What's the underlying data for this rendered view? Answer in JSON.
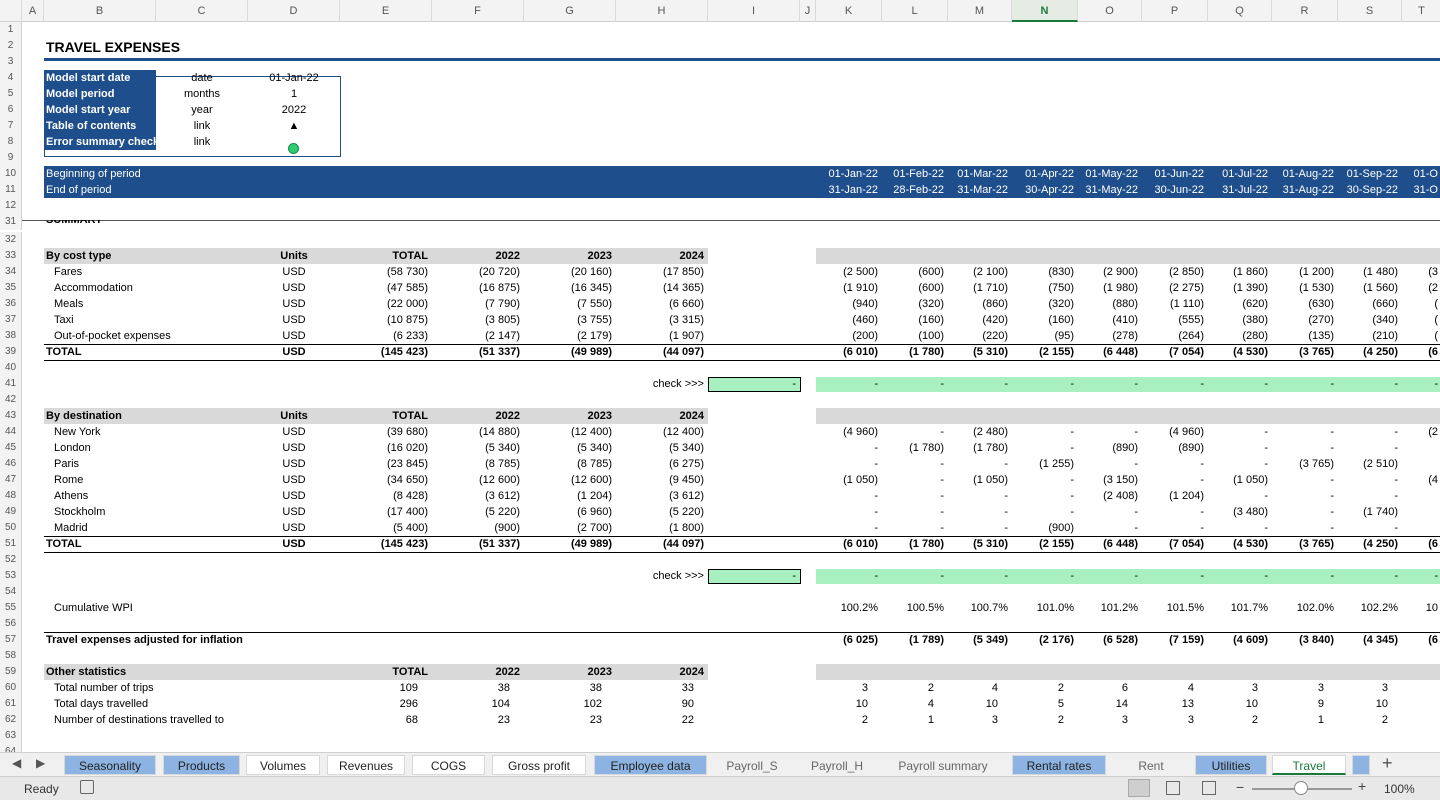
{
  "columns": [
    "A",
    "B",
    "C",
    "D",
    "E",
    "F",
    "G",
    "H",
    "I",
    "J",
    "K",
    "L",
    "M",
    "N",
    "O",
    "P",
    "Q",
    "R",
    "S",
    "T"
  ],
  "rows": [
    "1",
    "2",
    "3",
    "4",
    "5",
    "6",
    "7",
    "8",
    "9",
    "10",
    "11",
    "12",
    "31",
    "32",
    "33",
    "34",
    "35",
    "36",
    "37",
    "38",
    "39",
    "40",
    "41",
    "42",
    "43",
    "44",
    "45",
    "46",
    "47",
    "48",
    "49",
    "50",
    "51",
    "52",
    "53",
    "54",
    "55",
    "56",
    "57",
    "58",
    "59",
    "60",
    "61",
    "62",
    "63",
    "64"
  ],
  "title": "TRAVEL EXPENSES",
  "params": [
    {
      "label": "Model start date",
      "unit": "date",
      "value": "01-Jan-22"
    },
    {
      "label": "Model period",
      "unit": "months",
      "value": "1"
    },
    {
      "label": "Model start year",
      "unit": "year",
      "value": "2022"
    },
    {
      "label": "Table of contents",
      "unit": "link",
      "value": "▲"
    },
    {
      "label": "Error summary check",
      "unit": "link",
      "value": ""
    }
  ],
  "period": {
    "begin_label": "Beginning of period",
    "end_label": "End of period",
    "begin": [
      "01-Jan-22",
      "01-Feb-22",
      "01-Mar-22",
      "01-Apr-22",
      "01-May-22",
      "01-Jun-22",
      "01-Jul-22",
      "01-Aug-22",
      "01-Sep-22",
      "01-O"
    ],
    "end": [
      "31-Jan-22",
      "28-Feb-22",
      "31-Mar-22",
      "30-Apr-22",
      "31-May-22",
      "30-Jun-22",
      "31-Jul-22",
      "31-Aug-22",
      "30-Sep-22",
      "31-O"
    ]
  },
  "summary_label": "SUMMARY",
  "header_cols": [
    "Units",
    "TOTAL",
    "2022",
    "2023",
    "2024"
  ],
  "by_cost": {
    "title": "By cost type",
    "rows": [
      {
        "name": "Fares",
        "unit": "USD",
        "vals": [
          "(58 730)",
          "(20 720)",
          "(20 160)",
          "(17 850)"
        ],
        "m": [
          "(2 500)",
          "(600)",
          "(2 100)",
          "(830)",
          "(2 900)",
          "(2 850)",
          "(1 860)",
          "(1 200)",
          "(1 480)",
          "(3"
        ]
      },
      {
        "name": "Accommodation",
        "unit": "USD",
        "vals": [
          "(47 585)",
          "(16 875)",
          "(16 345)",
          "(14 365)"
        ],
        "m": [
          "(1 910)",
          "(600)",
          "(1 710)",
          "(750)",
          "(1 980)",
          "(2 275)",
          "(1 390)",
          "(1 530)",
          "(1 560)",
          "(2"
        ]
      },
      {
        "name": "Meals",
        "unit": "USD",
        "vals": [
          "(22 000)",
          "(7 790)",
          "(7 550)",
          "(6 660)"
        ],
        "m": [
          "(940)",
          "(320)",
          "(860)",
          "(320)",
          "(880)",
          "(1 110)",
          "(620)",
          "(630)",
          "(660)",
          "("
        ]
      },
      {
        "name": "Taxi",
        "unit": "USD",
        "vals": [
          "(10 875)",
          "(3 805)",
          "(3 755)",
          "(3 315)"
        ],
        "m": [
          "(460)",
          "(160)",
          "(420)",
          "(160)",
          "(410)",
          "(555)",
          "(380)",
          "(270)",
          "(340)",
          "("
        ]
      },
      {
        "name": "Out-of-pocket expenses",
        "unit": "USD",
        "vals": [
          "(6 233)",
          "(2 147)",
          "(2 179)",
          "(1 907)"
        ],
        "m": [
          "(200)",
          "(100)",
          "(220)",
          "(95)",
          "(278)",
          "(264)",
          "(280)",
          "(135)",
          "(210)",
          "("
        ]
      }
    ],
    "total": {
      "name": "TOTAL",
      "unit": "USD",
      "vals": [
        "(145 423)",
        "(51 337)",
        "(49 989)",
        "(44 097)"
      ],
      "m": [
        "(6 010)",
        "(1 780)",
        "(5 310)",
        "(2 155)",
        "(6 448)",
        "(7 054)",
        "(4 530)",
        "(3 765)",
        "(4 250)",
        "(6"
      ]
    }
  },
  "check_label": "check >>>",
  "check_value": "-",
  "by_dest": {
    "title": "By destination",
    "rows": [
      {
        "name": "New York",
        "unit": "USD",
        "vals": [
          "(39 680)",
          "(14 880)",
          "(12 400)",
          "(12 400)"
        ],
        "m": [
          "(4 960)",
          "-",
          "(2 480)",
          "-",
          "-",
          "(4 960)",
          "-",
          "-",
          "-",
          "(2"
        ]
      },
      {
        "name": "London",
        "unit": "USD",
        "vals": [
          "(16 020)",
          "(5 340)",
          "(5 340)",
          "(5 340)"
        ],
        "m": [
          "-",
          "(1 780)",
          "(1 780)",
          "-",
          "(890)",
          "(890)",
          "-",
          "-",
          "-",
          ""
        ]
      },
      {
        "name": "Paris",
        "unit": "USD",
        "vals": [
          "(23 845)",
          "(8 785)",
          "(8 785)",
          "(6 275)"
        ],
        "m": [
          "-",
          "-",
          "-",
          "(1 255)",
          "-",
          "-",
          "-",
          "(3 765)",
          "(2 510)",
          ""
        ]
      },
      {
        "name": "Rome",
        "unit": "USD",
        "vals": [
          "(34 650)",
          "(12 600)",
          "(12 600)",
          "(9 450)"
        ],
        "m": [
          "(1 050)",
          "-",
          "(1 050)",
          "-",
          "(3 150)",
          "-",
          "(1 050)",
          "-",
          "-",
          "(4"
        ]
      },
      {
        "name": "Athens",
        "unit": "USD",
        "vals": [
          "(8 428)",
          "(3 612)",
          "(1 204)",
          "(3 612)"
        ],
        "m": [
          "-",
          "-",
          "-",
          "-",
          "(2 408)",
          "(1 204)",
          "-",
          "-",
          "-",
          ""
        ]
      },
      {
        "name": "Stockholm",
        "unit": "USD",
        "vals": [
          "(17 400)",
          "(5 220)",
          "(6 960)",
          "(5 220)"
        ],
        "m": [
          "-",
          "-",
          "-",
          "-",
          "-",
          "-",
          "(3 480)",
          "-",
          "(1 740)",
          ""
        ]
      },
      {
        "name": "Madrid",
        "unit": "USD",
        "vals": [
          "(5 400)",
          "(900)",
          "(2 700)",
          "(1 800)"
        ],
        "m": [
          "-",
          "-",
          "-",
          "(900)",
          "-",
          "-",
          "-",
          "-",
          "-",
          ""
        ]
      }
    ],
    "total": {
      "name": "TOTAL",
      "unit": "USD",
      "vals": [
        "(145 423)",
        "(51 337)",
        "(49 989)",
        "(44 097)"
      ],
      "m": [
        "(6 010)",
        "(1 780)",
        "(5 310)",
        "(2 155)",
        "(6 448)",
        "(7 054)",
        "(4 530)",
        "(3 765)",
        "(4 250)",
        "(6"
      ]
    }
  },
  "wpi": {
    "name": "Cumulative WPI",
    "m": [
      "100.2%",
      "100.5%",
      "100.7%",
      "101.0%",
      "101.2%",
      "101.5%",
      "101.7%",
      "102.0%",
      "102.2%",
      "10"
    ]
  },
  "adjusted": {
    "name": "Travel expenses adjusted for inflation",
    "m": [
      "(6 025)",
      "(1 789)",
      "(5 349)",
      "(2 176)",
      "(6 528)",
      "(7 159)",
      "(4 609)",
      "(3 840)",
      "(4 345)",
      "(6"
    ]
  },
  "other": {
    "title": "Other statistics",
    "cols": [
      "TOTAL",
      "2022",
      "2023",
      "2024"
    ],
    "rows": [
      {
        "name": "Total number of trips",
        "vals": [
          "109",
          "38",
          "38",
          "33"
        ],
        "m": [
          "3",
          "2",
          "4",
          "2",
          "6",
          "4",
          "3",
          "3",
          "3",
          ""
        ]
      },
      {
        "name": "Total days travelled",
        "vals": [
          "296",
          "104",
          "102",
          "90"
        ],
        "m": [
          "10",
          "4",
          "10",
          "5",
          "14",
          "13",
          "10",
          "9",
          "10",
          ""
        ]
      },
      {
        "name": "Number of destinations travelled to",
        "vals": [
          "68",
          "23",
          "23",
          "22"
        ],
        "m": [
          "2",
          "1",
          "3",
          "2",
          "3",
          "3",
          "2",
          "1",
          "2",
          ""
        ]
      }
    ]
  },
  "tabs": [
    {
      "label": "Seasonality",
      "style": "blue"
    },
    {
      "label": "Products",
      "style": "blue"
    },
    {
      "label": "Volumes",
      "style": "white"
    },
    {
      "label": "Revenues",
      "style": "white"
    },
    {
      "label": "COGS",
      "style": "white"
    },
    {
      "label": "Gross profit",
      "style": "white"
    },
    {
      "label": "Employee data",
      "style": "blue"
    },
    {
      "label": "Payroll_S",
      "style": "grey"
    },
    {
      "label": "Payroll_H",
      "style": "grey"
    },
    {
      "label": "Payroll summary",
      "style": "grey"
    },
    {
      "label": "Rental rates",
      "style": "blue"
    },
    {
      "label": "Rent",
      "style": "grey"
    },
    {
      "label": "Utilities",
      "style": "blue"
    },
    {
      "label": "Travel",
      "style": "active"
    }
  ],
  "status": {
    "ready": "Ready",
    "zoom": "100%"
  },
  "colors": {
    "navy": "#1f4e8c",
    "band": "#d9d9d9",
    "check_green": "#a8f0c0",
    "accent": "#1a7a3c"
  }
}
